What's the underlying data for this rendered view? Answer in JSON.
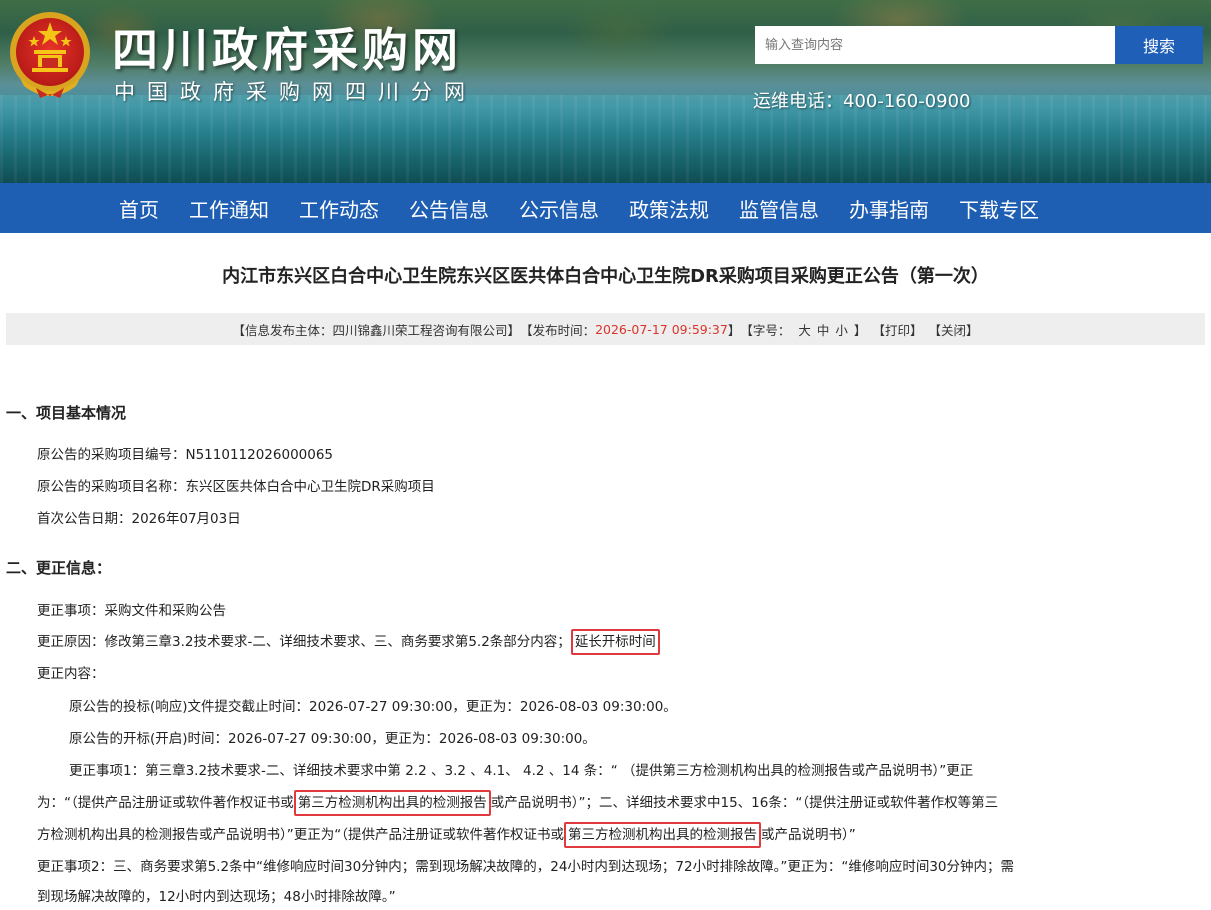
{
  "header": {
    "site_title": "四川政府采购网",
    "site_subtitle": "中国政府采购网四川分网",
    "search_placeholder": "输入查询内容",
    "search_button": "搜索",
    "hotline": "运维电话：400-160-0900"
  },
  "nav": [
    "首页",
    "工作通知",
    "工作动态",
    "公告信息",
    "公示信息",
    "政策法规",
    "监管信息",
    "办事指南",
    "下载专区"
  ],
  "article": {
    "title": "内江市东兴区白合中心卫生院东兴区医共体白合中心卫生院DR采购项目采购更正公告（第一次）",
    "meta": {
      "publisher_prefix": "【信息发布主体：",
      "publisher": "四川锦鑫川荣工程咨询有限公司",
      "publisher_suffix": "】",
      "time_prefix": "【发布时间：",
      "time": "2026-07-17 09:59:37",
      "time_suffix": "】",
      "font_prefix": "【字号：",
      "font_large": "大",
      "font_medium": "中",
      "font_small": "小",
      "font_suffix": "】",
      "print": "【打印】",
      "close": "【关闭】"
    },
    "section1": {
      "heading": "一、项目基本情况",
      "lines": [
        "原公告的采购项目编号：N5110112026000065",
        "原公告的采购项目名称：东兴区医共体白合中心卫生院DR采购项目",
        "首次公告日期：2026年07月03日"
      ]
    },
    "section2": {
      "heading": "二、更正信息：",
      "item": "更正事项：采购文件和采购公告",
      "reason_prefix": "更正原因：修改第三章3.2技术要求-二、详细技术要求、三、商务要求第5.2条部分内容；",
      "reason_highlight": "延长开标时间",
      "content_label": "更正内容：",
      "deadline": "原公告的投标(响应)文件提交截止时间：2026-07-27 09:30:00，更正为：2026-08-03 09:30:00。",
      "opening": "原公告的开标(开启)时间：2026-07-27 09:30:00，更正为：2026-08-03 09:30:00。",
      "item1_line1": "更正事项1：第三章3.2技术要求-二、详细技术要求中第 2.2 、3.2  、4.1、 4.2 、14 条：“ （提供第三方检测机构出具的检测报告或产品说明书）”更正",
      "item1_line2_a": "为：“（提供产品注册证或软件著作权证书或",
      "item1_line2_hl": "第三方检测机构出具的检测报告",
      "item1_line2_b": "或产品说明书）”；二、详细技术要求中15、16条：“（提供注册证或软件著作权等第三",
      "item1_line3_a": "方检测机构出具的检测报告或产品说明书）”更正为“（提供产品注册证或软件著作权证书或",
      "item1_line3_hl": "第三方检测机构出具的检测报告",
      "item1_line3_b": "或产品说明书）”",
      "item2_line1": "更正事项2：三、商务要求第5.2条中“维修响应时间30分钟内；需到现场解决故障的，24小时内到达现场；72小时排除故障。”更正为：“维修响应时间30分钟内；需",
      "item2_line2": "到现场解决故障的，12小时内到达现场；48小时排除故障。”"
    }
  },
  "colors": {
    "nav_bg": "#1e5fb3",
    "search_button_bg": "#1f5fb8",
    "highlight_border": "#e0393e",
    "time_text": "#d9342b"
  }
}
